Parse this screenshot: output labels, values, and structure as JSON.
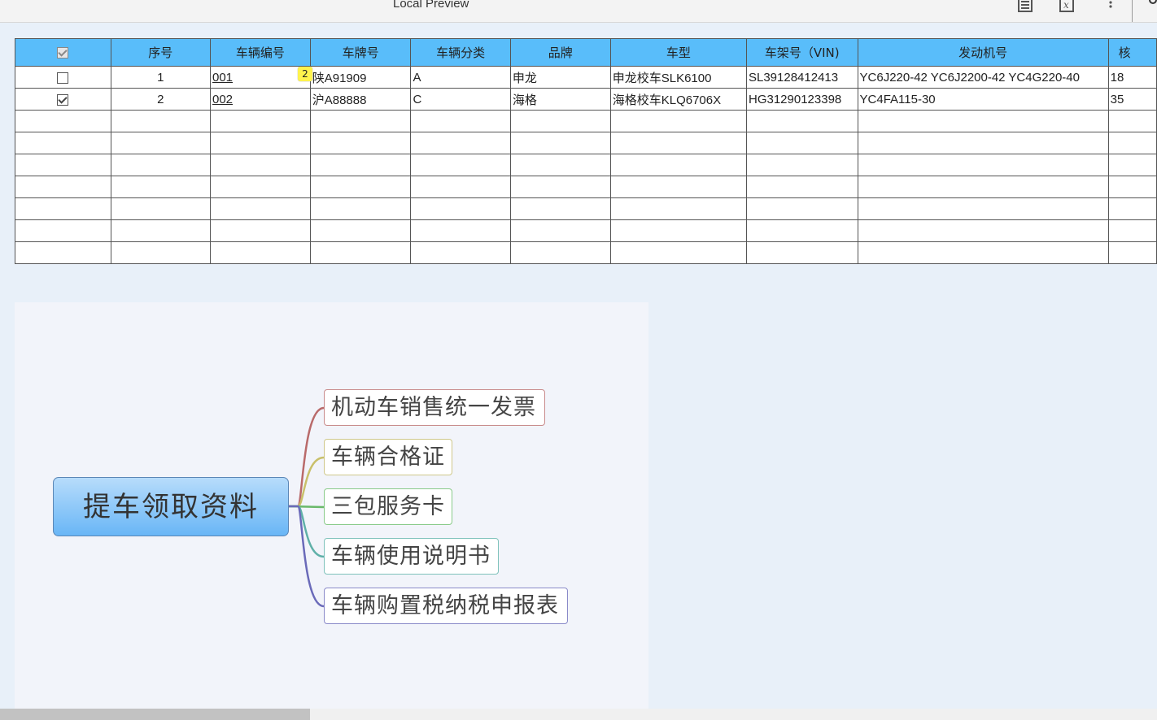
{
  "window": {
    "title": "Local Preview",
    "toolbar_icons": [
      "document-icon",
      "formula-icon",
      "more-vertical-icon"
    ]
  },
  "table": {
    "headers": [
      "",
      "序号",
      "车辆编号",
      "车牌号",
      "车辆分类",
      "品牌",
      "车型",
      "车架号（VIN)",
      "发动机号",
      "核"
    ],
    "rows": [
      {
        "checked": false,
        "seq": "1",
        "vehicle_no": "001",
        "plate": "陕A91909",
        "category": "A",
        "brand": "申龙",
        "model": "申龙校车SLK6100",
        "vin": "SL39128412413",
        "engine": "YC6J220-42 YC6J2200-42 YC4G220-40",
        "extra": "18"
      },
      {
        "checked": true,
        "seq": "2",
        "vehicle_no": "002",
        "plate": "沪A88888",
        "category": "C",
        "brand": "海格",
        "model": "海格校车KLQ6706X",
        "vin": "HG31290123398",
        "engine": "YC4FA115-30",
        "extra": "35"
      }
    ],
    "empty_rows": 7,
    "badge": "2"
  },
  "mindmap": {
    "root": "提车领取资料",
    "branches": [
      {
        "label": "机动车销售统一发票",
        "color": "#b96a6a"
      },
      {
        "label": "车辆合格证",
        "color": "#c9c06a"
      },
      {
        "label": "三包服务卡",
        "color": "#6ab96a"
      },
      {
        "label": "车辆使用说明书",
        "color": "#5fb0a8"
      },
      {
        "label": "车辆购置税纳税申报表",
        "color": "#6a6ab9"
      }
    ]
  },
  "colors": {
    "header_bg": "#59bdfa",
    "page_bg": "#e8f0f9"
  }
}
